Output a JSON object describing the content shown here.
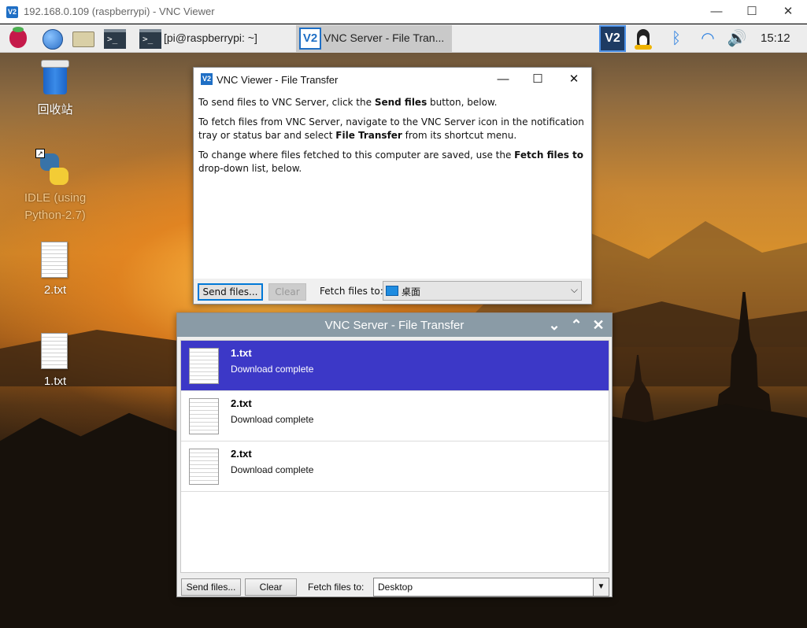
{
  "host_window": {
    "title": "192.168.0.109 (raspberrypi) - VNC Viewer",
    "logo_text": "V2",
    "controls": {
      "minimize": "—",
      "maximize": "☐",
      "close": "✕"
    }
  },
  "taskbar": {
    "terminal_task_label": "[pi@raspberrypi: ~]",
    "active_task_label": "VNC Server - File Tran...",
    "active_task_logo": "V2",
    "tray_vnc_logo": "V2",
    "bluetooth_glyph": "ᛒ",
    "wifi_glyph": "◠",
    "volume_glyph": "🔊",
    "clock": "15:12",
    "terminal_glyph": ">_"
  },
  "desktop": {
    "icons": [
      {
        "label": "回收站",
        "icon": "trash-icon"
      },
      {
        "label_line1": "IDLE (using",
        "label_line2": "Python-2.7)",
        "icon": "python-icon"
      },
      {
        "label": "2.txt",
        "icon": "text-file-icon"
      },
      {
        "label": "1.txt",
        "icon": "text-file-icon"
      }
    ]
  },
  "viewer_dialog": {
    "title": "VNC Viewer - File Transfer",
    "logo_text": "V2",
    "controls": {
      "minimize": "—",
      "maximize": "☐",
      "close": "✕"
    },
    "para1_pre": "To send files to VNC Server, click the ",
    "para1_bold": "Send files",
    "para1_post": " button, below.",
    "para2_pre": "To fetch files from VNC Server, navigate to the VNC Server icon in the notification tray or status bar and select ",
    "para2_bold": "File Transfer",
    "para2_post": " from its shortcut menu.",
    "para3_pre": "To change where files fetched to this computer are saved, use the ",
    "para3_bold": "Fetch files to",
    "para3_post": " drop-down list, below.",
    "send_button": "Send files...",
    "clear_button": "Clear",
    "fetch_label": "Fetch files to:",
    "fetch_value": "桌面",
    "dropdown_arrow": "⌵"
  },
  "server_panel": {
    "title": "VNC Server - File Transfer",
    "controls": {
      "down": "⌄",
      "up": "⌃",
      "close": "✕"
    },
    "files": [
      {
        "name": "1.txt",
        "status": "Download complete",
        "selected": true
      },
      {
        "name": "2.txt",
        "status": "Download complete",
        "selected": false
      },
      {
        "name": "2.txt",
        "status": "Download complete",
        "selected": false
      }
    ],
    "send_button": "Send files...",
    "clear_button": "Clear",
    "fetch_label": "Fetch files to:",
    "fetch_value": "Desktop",
    "dropdown_arrow": "▼",
    "accent_color": "#3c38c7"
  }
}
